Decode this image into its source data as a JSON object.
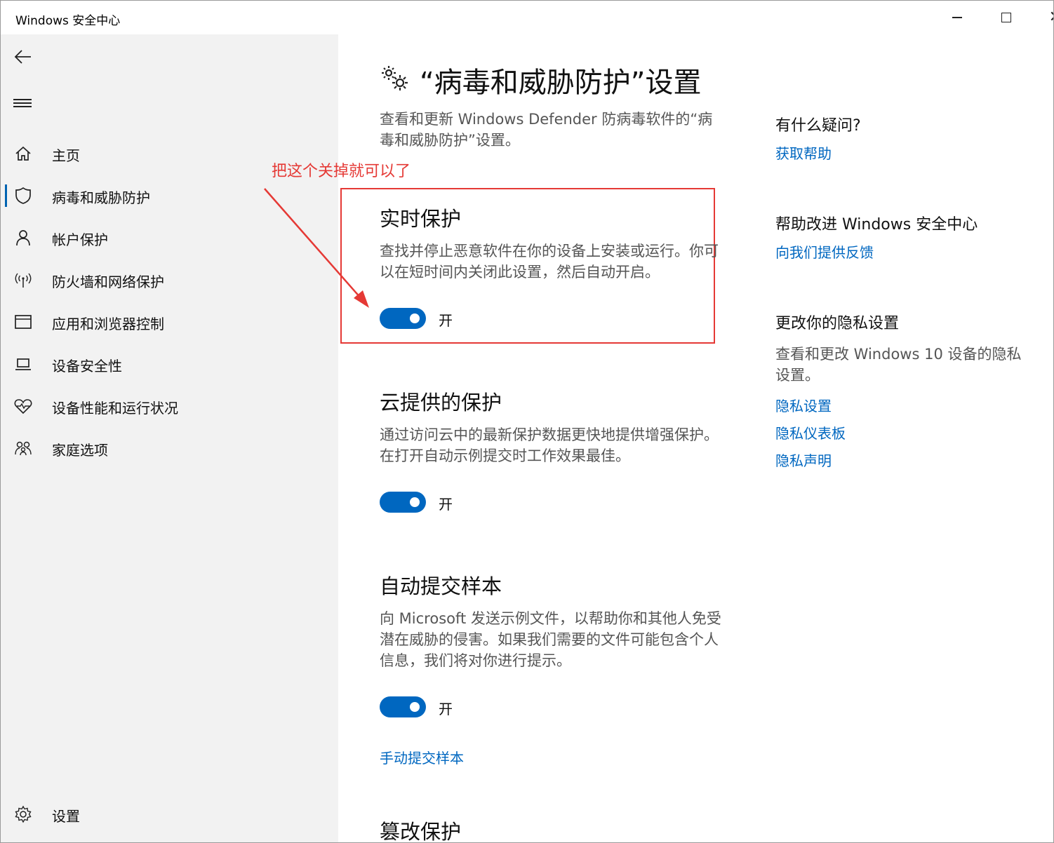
{
  "window": {
    "title": "Windows 安全中心"
  },
  "sidebar": {
    "items": [
      {
        "id": "home",
        "label": "主页",
        "icon": "home-icon"
      },
      {
        "id": "virus",
        "label": "病毒和威胁防护",
        "icon": "shield-icon",
        "active": true
      },
      {
        "id": "account",
        "label": "帐户保护",
        "icon": "person-icon"
      },
      {
        "id": "firewall",
        "label": "防火墙和网络保护",
        "icon": "wireless-icon"
      },
      {
        "id": "app",
        "label": "应用和浏览器控制",
        "icon": "browser-window-icon"
      },
      {
        "id": "device-security",
        "label": "设备安全性",
        "icon": "laptop-icon"
      },
      {
        "id": "device-health",
        "label": "设备性能和运行状况",
        "icon": "heart-pulse-icon"
      },
      {
        "id": "family",
        "label": "家庭选项",
        "icon": "family-icon"
      }
    ],
    "settings_label": "设置"
  },
  "main": {
    "title": "“病毒和威胁防护”设置",
    "description": "查看和更新 Windows Defender 防病毒软件的“病毒和威胁防护”设置。",
    "annotation": "把这个关掉就可以了",
    "sections": {
      "realtime": {
        "title": "实时保护",
        "description": "查找并停止恶意软件在你的设备上安装或运行。你可以在短时间内关闭此设置，然后自动开启。",
        "state": "开",
        "on": true
      },
      "cloud": {
        "title": "云提供的保护",
        "description": "通过访问云中的最新保护数据更快地提供增强保护。在打开自动示例提交时工作效果最佳。",
        "state": "开",
        "on": true
      },
      "sample": {
        "title": "自动提交样本",
        "description": "向 Microsoft 发送示例文件，以帮助你和其他人免受潜在威胁的侵害。如果我们需要的文件可能包含个人信息，我们将对你进行提示。",
        "state": "开",
        "on": true,
        "manual_link": "手动提交样本"
      },
      "tamper": {
        "title": "篡改保护"
      }
    }
  },
  "aside": {
    "question_title": "有什么疑问?",
    "help_link": "获取帮助",
    "improve_title": "帮助改进 Windows 安全中心",
    "feedback_link": "向我们提供反馈",
    "privacy_title": "更改你的隐私设置",
    "privacy_desc": "查看和更改 Windows 10 设备的隐私设置。",
    "privacy_settings_link": "隐私设置",
    "privacy_dashboard_link": "隐私仪表板",
    "privacy_statement_link": "隐私声明"
  },
  "colors": {
    "accent": "#0067c0",
    "annotation": "#e53935",
    "sidebar_bg": "#f2f2f2"
  }
}
